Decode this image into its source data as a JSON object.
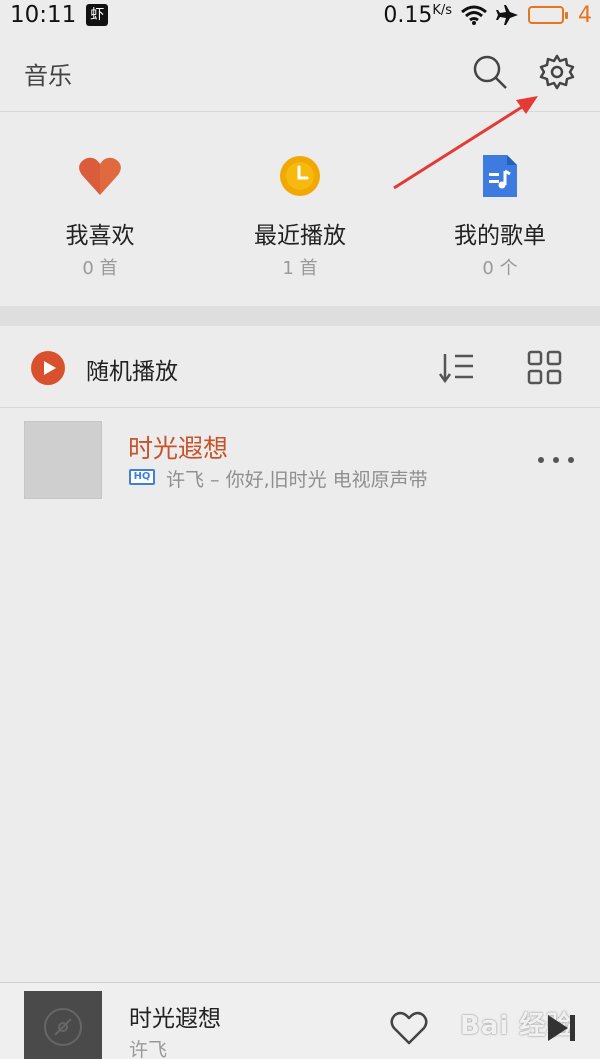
{
  "status_bar": {
    "time": "10:11",
    "app_badge": "虾",
    "net_speed": "0.15",
    "net_unit": "K/s",
    "battery_level": "4"
  },
  "header": {
    "title": "音乐",
    "search_icon": "search-icon",
    "settings_icon": "gear-icon"
  },
  "tiles": [
    {
      "name": "我喜欢",
      "count": "0 首",
      "icon": "heart-icon",
      "color": "#e06a3e"
    },
    {
      "name": "最近播放",
      "count": "1 首",
      "icon": "clock-icon",
      "color": "#f1a800"
    },
    {
      "name": "我的歌单",
      "count": "0 个",
      "icon": "playlist-doc-icon",
      "color": "#3d7be0"
    }
  ],
  "shuffle": {
    "label": "随机播放",
    "icon": "play-circle-icon",
    "accent": "#d9512c"
  },
  "songs": [
    {
      "title": "时光遐想",
      "badge": "HQ",
      "subtitle": "许飞 – 你好,旧时光 电视原声带"
    }
  ],
  "mini_player": {
    "title": "时光遐想",
    "artist": "许飞"
  },
  "watermark": "Bai 经验",
  "colors": {
    "accent": "#c7532b",
    "annotation_arrow": "#e53935"
  }
}
